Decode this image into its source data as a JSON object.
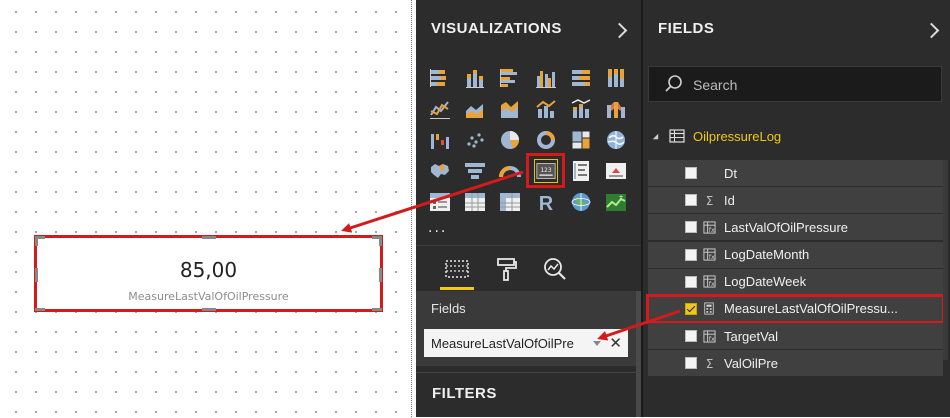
{
  "canvas": {
    "card_value": "85,00",
    "card_label": "MeasureLastValOfOilPressure"
  },
  "visualizations": {
    "title": "VISUALIZATIONS",
    "more": "...",
    "icons": [
      [
        "stacked-bar-icon",
        "stacked-column-icon",
        "clustered-bar-icon",
        "clustered-column-icon",
        "100-stacked-bar-icon",
        "100-stacked-column-icon"
      ],
      [
        "line-chart-icon",
        "area-chart-icon",
        "stacked-area-icon",
        "line-and-column-icon",
        "line-and-stacked-column-icon",
        "ribbon-chart-icon"
      ],
      [
        "waterfall-icon",
        "scatter-icon",
        "pie-icon",
        "donut-icon",
        "treemap-icon",
        "map-icon"
      ],
      [
        "filled-map-icon",
        "funnel-icon",
        "gauge-icon",
        "card-icon",
        "multi-row-card-icon",
        "kpi-icon"
      ],
      [
        "slicer-icon",
        "table-icon",
        "matrix-icon",
        "r-visual-icon",
        "globe-icon",
        "custom-visual-icon"
      ]
    ],
    "tabs": [
      "fields-tab",
      "format-tab",
      "analytics-tab"
    ],
    "fields_well_label": "Fields",
    "field_pill": "MeasureLastValOfOilPre",
    "filters_title": "FILTERS"
  },
  "fields_pane": {
    "title": "FIELDS",
    "search_placeholder": "Search",
    "table_name": "OilpressureLog",
    "fields": [
      {
        "name": "Dt",
        "icon": "none",
        "checked": false
      },
      {
        "name": "Id",
        "icon": "sigma",
        "checked": false
      },
      {
        "name": "LastValOfOilPressure",
        "icon": "calc-column",
        "checked": false
      },
      {
        "name": "LogDateMonth",
        "icon": "calc-column",
        "checked": false
      },
      {
        "name": "LogDateWeek",
        "icon": "calc-column",
        "checked": false
      },
      {
        "name": "MeasureLastValOfOilPressu...",
        "icon": "measure",
        "checked": true
      },
      {
        "name": "TargetVal",
        "icon": "calc-column",
        "checked": false
      },
      {
        "name": "ValOilPre",
        "icon": "sigma",
        "checked": false
      }
    ]
  },
  "colors": {
    "highlight_red": "#d41b1b",
    "accent_yellow": "#f2c811",
    "pane_bg": "#2c2c2c"
  }
}
